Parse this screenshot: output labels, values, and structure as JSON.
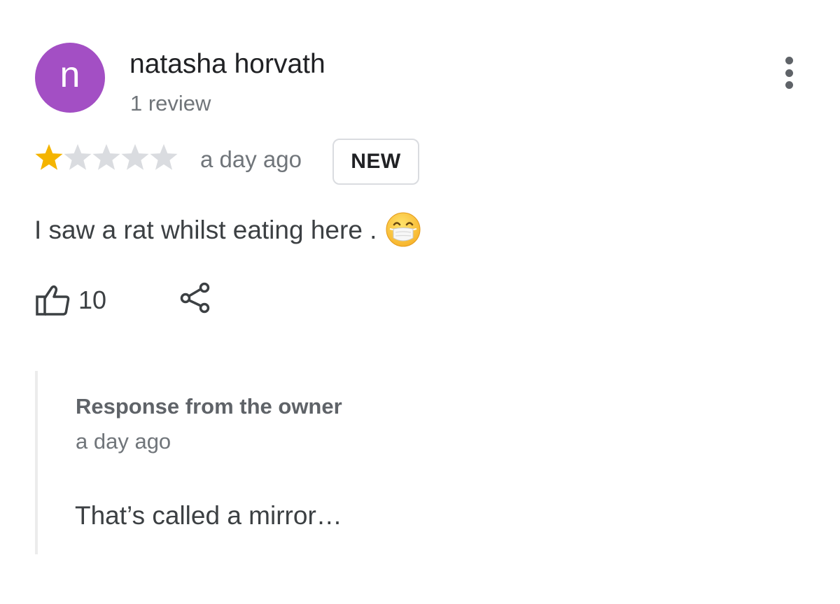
{
  "review": {
    "avatar_letter": "n",
    "avatar_color": "#a34fc4",
    "reviewer_name": "natasha horvath",
    "review_count": "1 review",
    "more_icon": "more-vert-icon",
    "rating": 1,
    "rating_max": 5,
    "star_filled_color": "#f4b400",
    "star_empty_color": "#dadce0",
    "time_ago": "a day ago",
    "badge": "NEW",
    "text": "I saw a rat whilst eating here .",
    "emoji": "😷",
    "emoji_icon": "face-with-medical-mask-icon",
    "like_icon": "thumbs-up-icon",
    "like_count": "10",
    "share_icon": "share-icon"
  },
  "owner_response": {
    "title": "Response from the owner",
    "time_ago": "a day ago",
    "text": "That’s called a mirror…"
  }
}
